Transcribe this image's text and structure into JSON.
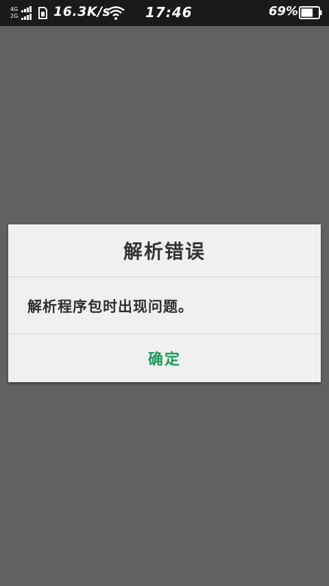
{
  "status_bar": {
    "network_top": "4G",
    "network_bottom": "2G",
    "speed": "16.3K/s",
    "time": "17:46",
    "battery_percent": "69%",
    "battery_level": 0.69,
    "icons": [
      "signal-icon",
      "sim-icon",
      "wifi-icon",
      "battery-icon"
    ]
  },
  "dialog": {
    "title": "解析错误",
    "message": "解析程序包时出现问题。",
    "confirm_label": "确定"
  },
  "colors": {
    "status_bar_bg": "#1a1a1a",
    "backdrop": "#616161",
    "dialog_bg": "#f0f0f0",
    "accent": "#1a9a5c"
  }
}
